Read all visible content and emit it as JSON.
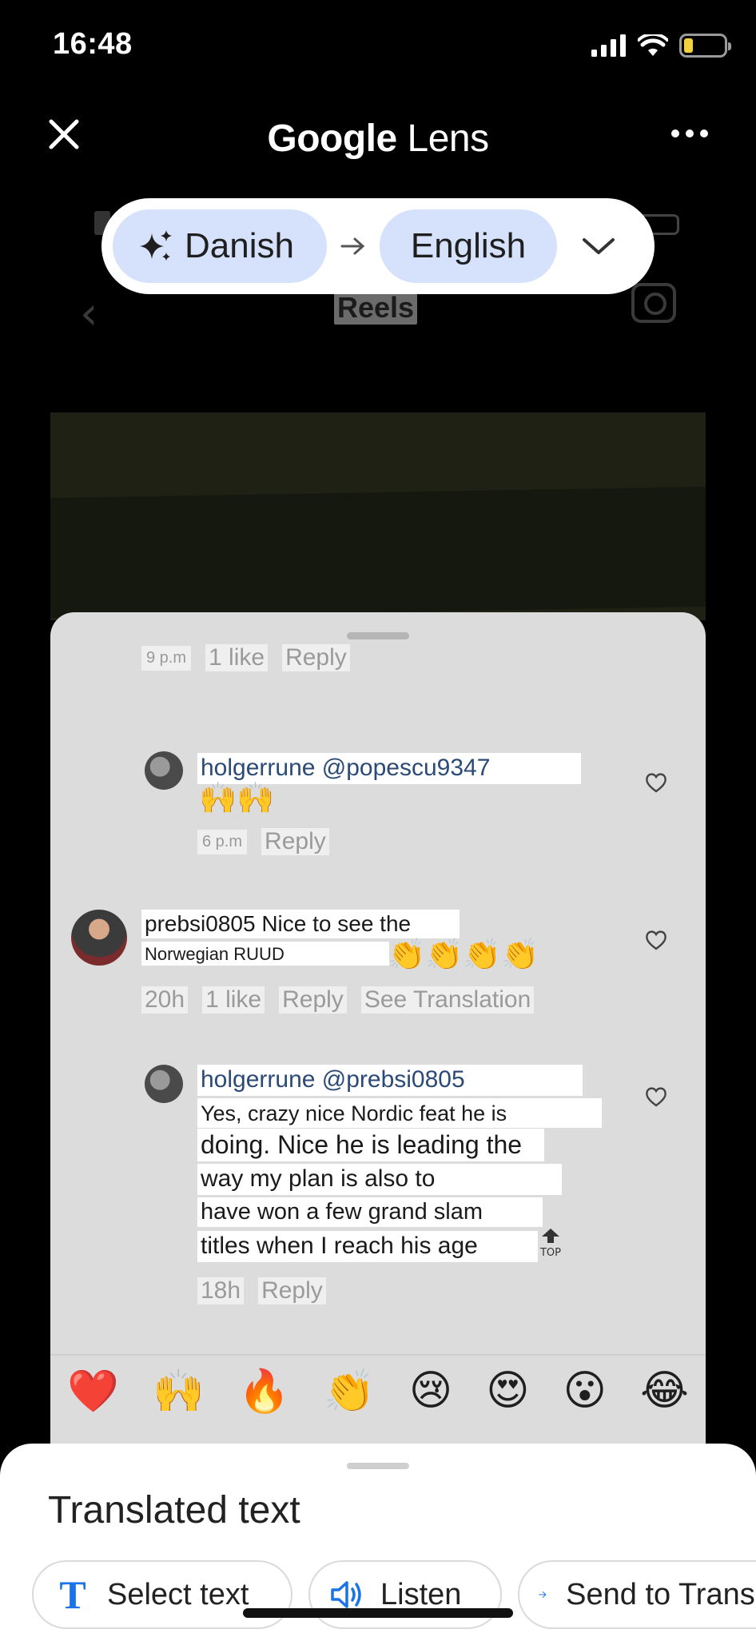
{
  "status": {
    "time": "16:48"
  },
  "header": {
    "title_prefix": "Google",
    "title_suffix": "Lens"
  },
  "background": {
    "page_title": "Reels"
  },
  "language": {
    "source": "Danish",
    "target": "English"
  },
  "comments": [
    {
      "time": "9 p.m",
      "likes": "1 like",
      "reply": "Reply"
    },
    {
      "text": "holgerrune @popescu9347",
      "emoji": "🙌🙌",
      "time": "6 p.m",
      "reply": "Reply"
    },
    {
      "line1": "prebsi0805 Nice to see the",
      "line2": "Norwegian RUUD",
      "emoji": "👏👏👏👏",
      "time": "20h",
      "likes": "1 like",
      "reply": "Reply",
      "see_translation": "See Translation"
    },
    {
      "text": "holgerrune @prebsi0805",
      "lines": [
        "Yes, crazy nice Nordic feat he is",
        "doing. Nice he is leading the",
        "way my plan is also to",
        "have won a few grand slam",
        "titles when I reach his age"
      ],
      "top_label": "TOP",
      "time": "18h",
      "reply": "Reply"
    }
  ],
  "reactions": [
    "❤️",
    "🙌",
    "🔥",
    "👏",
    "😢",
    "😍",
    "😮",
    "😂"
  ],
  "panel": {
    "title": "Translated text",
    "actions": {
      "select": "Select text",
      "listen": "Listen",
      "send": "Send to Translate"
    }
  },
  "colors": {
    "chip": "#d6e2fb",
    "accent": "#1a73e8",
    "sheet": "#dcdcdc"
  }
}
